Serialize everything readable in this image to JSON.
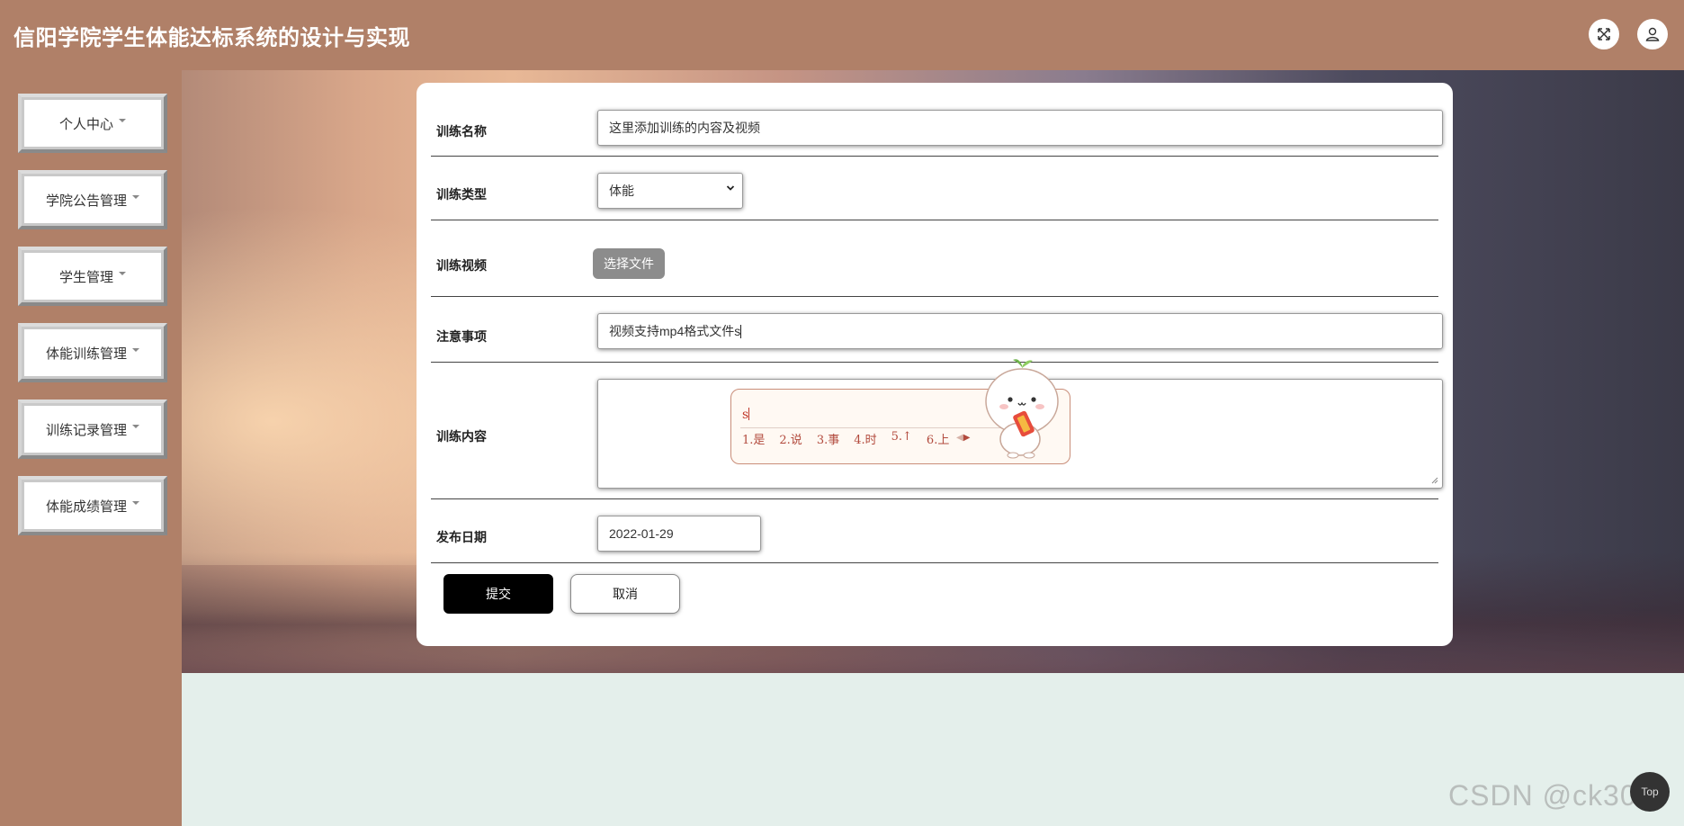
{
  "header": {
    "title": "信阳学院学生体能达标系统的设计与实现",
    "fullscreen_icon": "expand-icon",
    "user_icon": "user-icon"
  },
  "sidebar": {
    "items": [
      {
        "label": "个人中心"
      },
      {
        "label": "学院公告管理"
      },
      {
        "label": "学生管理"
      },
      {
        "label": "体能训练管理"
      },
      {
        "label": "训练记录管理"
      },
      {
        "label": "体能成绩管理"
      }
    ]
  },
  "form": {
    "name_label": "训练名称",
    "name_value": "这里添加训练的内容及视频",
    "type_label": "训练类型",
    "type_value": "体能",
    "video_label": "训练视频",
    "video_button": "选择文件",
    "notes_label": "注意事项",
    "notes_value": "视频支持mp4格式文件s",
    "content_label": "训练内容",
    "content_value": "",
    "date_label": "发布日期",
    "date_value": "2022-01-29",
    "submit_label": "提交",
    "cancel_label": "取消"
  },
  "ime": {
    "input": "s",
    "candidates": [
      "1.是",
      "2.说",
      "3.事",
      "4.时",
      "5.↑",
      "6.上"
    ]
  },
  "watermark": "CSDN @ck3017",
  "top_button": "Top",
  "colors": {
    "header_bg": "#b08068",
    "sidebar_bg": "#b08068",
    "page_bg": "#e4efeb",
    "submit_bg": "#000000"
  }
}
